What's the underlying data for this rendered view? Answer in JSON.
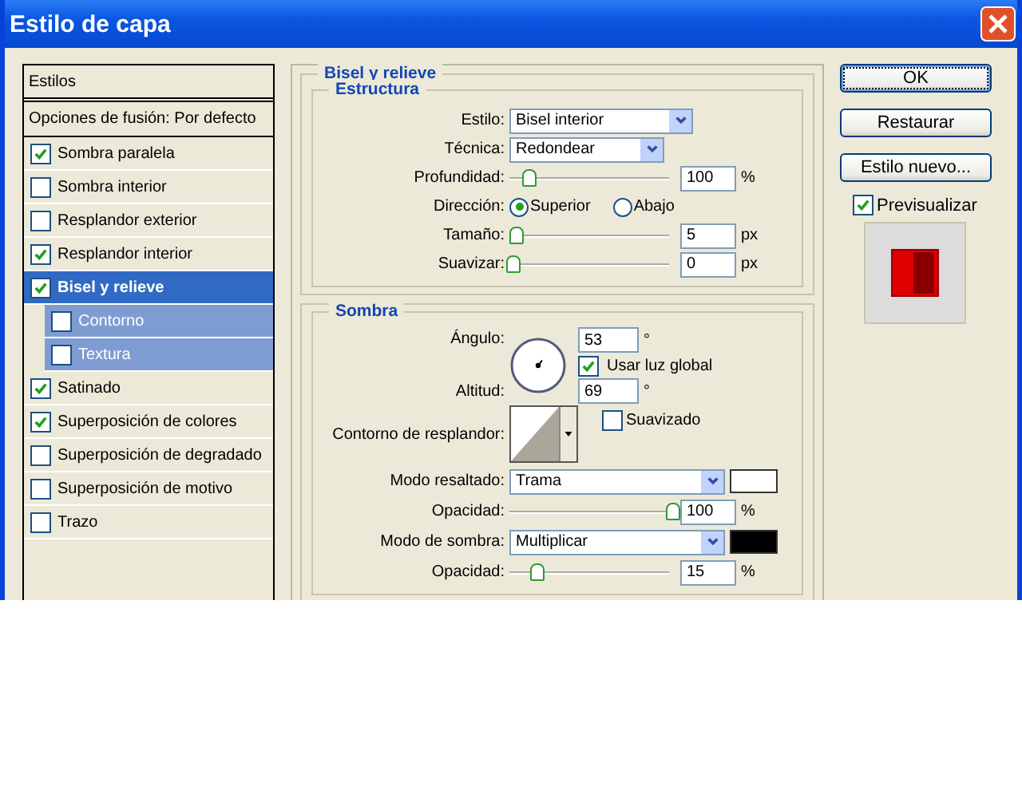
{
  "window": {
    "title": "Estilo de capa"
  },
  "styles": {
    "header": "Estilos",
    "blend_options": "Opciones de fusión: Por defecto",
    "items": [
      {
        "label": "Sombra paralela",
        "checked": true,
        "selected": false
      },
      {
        "label": "Sombra interior",
        "checked": false,
        "selected": false
      },
      {
        "label": "Resplandor exterior",
        "checked": false,
        "selected": false
      },
      {
        "label": "Resplandor interior",
        "checked": true,
        "selected": false
      },
      {
        "label": "Bisel y relieve",
        "checked": true,
        "selected": true,
        "children": [
          {
            "label": "Contorno",
            "checked": false,
            "selected": false
          },
          {
            "label": "Textura",
            "checked": false,
            "selected": false
          }
        ]
      },
      {
        "label": "Satinado",
        "checked": true,
        "selected": false
      },
      {
        "label": "Superposición de colores",
        "checked": true,
        "selected": false
      },
      {
        "label": "Superposición de degradado",
        "checked": false,
        "selected": false
      },
      {
        "label": "Superposición de motivo",
        "checked": false,
        "selected": false
      },
      {
        "label": "Trazo",
        "checked": false,
        "selected": false
      }
    ]
  },
  "bevel": {
    "title": "Bisel y relieve",
    "structure": {
      "title": "Estructura",
      "style": {
        "label": "Estilo:",
        "value": "Bisel interior"
      },
      "technique": {
        "label": "Técnica:",
        "value": "Redondear"
      },
      "depth": {
        "label": "Profundidad:",
        "level": 0.1,
        "value": "100",
        "unit": "%"
      },
      "direction": {
        "label": "Dirección:",
        "options": [
          {
            "label": "Superior",
            "selected": true
          },
          {
            "label": "Abajo",
            "selected": false
          }
        ]
      },
      "size": {
        "label": "Tamaño:",
        "level": 0.02,
        "value": "5",
        "unit": "px"
      },
      "soften": {
        "label": "Suavizar:",
        "level": 0,
        "value": "0",
        "unit": "px"
      }
    },
    "shading": {
      "title": "Sombra",
      "angle": {
        "label": "Ángulo:",
        "value": "53",
        "unit": "°"
      },
      "global_light": {
        "label": "Usar luz global",
        "checked": true
      },
      "altitude": {
        "label": "Altitud:",
        "value": "69",
        "unit": "°"
      },
      "gloss_contour": {
        "label": "Contorno de resplandor:"
      },
      "anti_aliased": {
        "label": "Suavizado",
        "checked": false
      },
      "highlight_mode": {
        "label": "Modo resaltado:",
        "value": "Trama",
        "color": "#ffffff"
      },
      "highlight_opacity": {
        "label": "Opacidad:",
        "level": 1,
        "value": "100",
        "unit": "%"
      },
      "shadow_mode": {
        "label": "Modo de sombra:",
        "value": "Multiplicar",
        "color": "#000000"
      },
      "shadow_opacity": {
        "label": "Opacidad:",
        "level": 0.15,
        "value": "15",
        "unit": "%"
      }
    }
  },
  "buttons": [
    {
      "label": "OK",
      "default": true
    },
    {
      "label": "Restaurar",
      "default": false
    },
    {
      "label": "Estilo nuevo...",
      "default": false
    }
  ],
  "preview": {
    "label": "Previsualizar",
    "checked": true
  }
}
